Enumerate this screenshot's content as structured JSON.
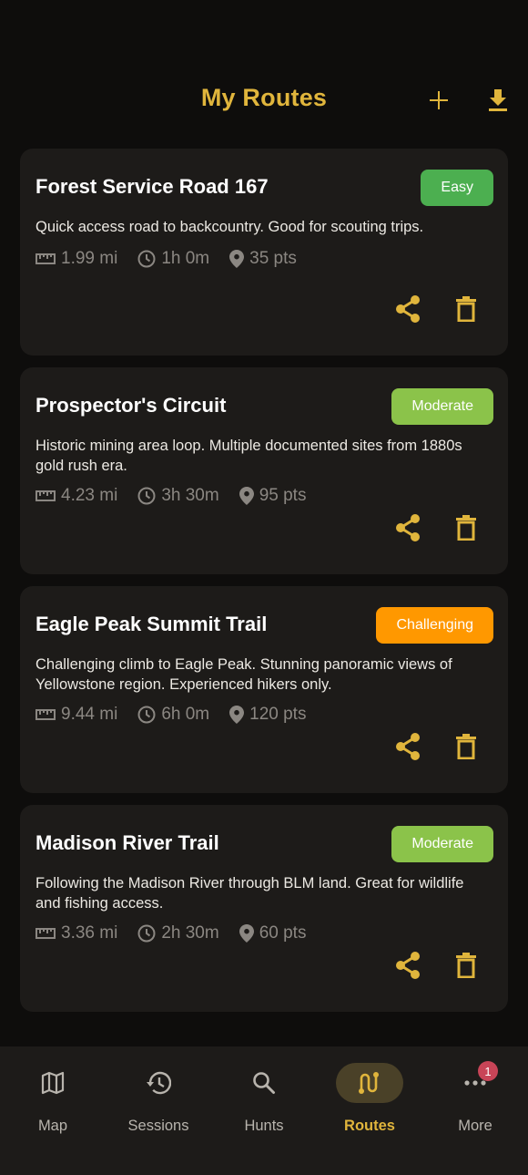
{
  "header": {
    "title": "My Routes"
  },
  "routes": [
    {
      "name": "Forest Service Road 167",
      "difficulty": "Easy",
      "difficulty_color": "#4caf50",
      "description": "Quick access road to backcountry. Good for scouting trips.",
      "distance": "1.99 mi",
      "duration": "1h 0m",
      "points": "35 pts"
    },
    {
      "name": "Prospector's Circuit",
      "difficulty": "Moderate",
      "difficulty_color": "#8bc34a",
      "description": "Historic mining area loop. Multiple documented sites from 1880s gold rush era.",
      "distance": "4.23 mi",
      "duration": "3h 30m",
      "points": "95 pts"
    },
    {
      "name": "Eagle Peak Summit Trail",
      "difficulty": "Challenging",
      "difficulty_color": "#ff9800",
      "description": "Challenging climb to Eagle Peak. Stunning panoramic views of Yellowstone region. Experienced hikers only.",
      "distance": "9.44 mi",
      "duration": "6h 0m",
      "points": "120 pts"
    },
    {
      "name": "Madison River Trail",
      "difficulty": "Moderate",
      "difficulty_color": "#8bc34a",
      "description": "Following the Madison River through BLM land. Great for wildlife and fishing access.",
      "distance": "3.36 mi",
      "duration": "2h 30m",
      "points": "60 pts"
    }
  ],
  "nav": {
    "items": [
      {
        "label": "Map",
        "icon": "map-icon"
      },
      {
        "label": "Sessions",
        "icon": "history-icon"
      },
      {
        "label": "Hunts",
        "icon": "search-icon"
      },
      {
        "label": "Routes",
        "icon": "route-icon"
      },
      {
        "label": "More",
        "icon": "more-icon",
        "badge": "1"
      }
    ],
    "active": "Routes"
  },
  "colors": {
    "accent": "#e0b53c",
    "background": "#0e0d0c",
    "card": "#1d1b19",
    "badge_notification": "#c84457"
  }
}
